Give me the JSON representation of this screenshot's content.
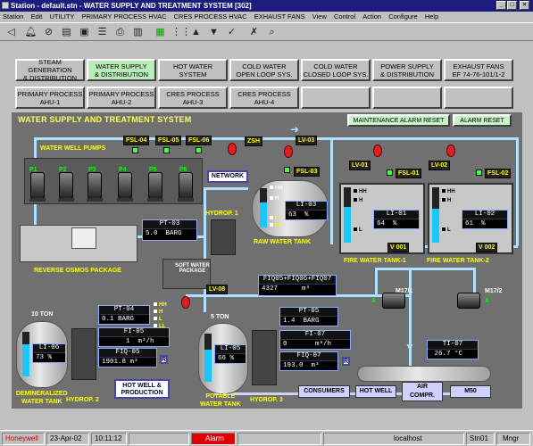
{
  "window": {
    "title": "Station - default.stn - WATER SUPPLY AND TREATMENT SYSTEM [302]",
    "controls": [
      "_",
      "□",
      "×"
    ]
  },
  "menu": [
    "Station",
    "Edit",
    "UTILITY",
    "PRIMARY PROCESS HVAC",
    "CRES PROCESS HVAC",
    "EXHAUST FANS",
    "View",
    "Control",
    "Action",
    "Configure",
    "Help"
  ],
  "toolbar": {
    "icons": [
      "back-icon",
      "bell-icon",
      "silence-icon",
      "report-icon",
      "alarm-summary-icon",
      "list-icon",
      "print-icon",
      "document-icon",
      "chart-icon",
      "grid-icon",
      "up-icon",
      "down-icon",
      "check-icon",
      "cross-icon",
      "search-icon"
    ]
  },
  "nav": {
    "row1": [
      "STEAM GENERATION\n& DISTRIBUTION",
      "WATER SUPPLY\n& DISTRIBUTION",
      "HOT WATER\nSYSTEM",
      "COLD WATER\nOPEN LOOP SYS.",
      "COLD WATER\nCLOSED LOOP SYS.",
      "POWER SUPPLY\n& DISTRIBUTION",
      "EXHAUST FANS\nEF 74-76-101/1-2"
    ],
    "row2": [
      "PRIMARY PROCESS\nAHU-1",
      "PRIMARY PROCESS\nAHU-2",
      "CRES PROCESS\nAHU-3",
      "CRES PROCESS\nAHU-4",
      "",
      "",
      ""
    ],
    "active_index": 1
  },
  "process": {
    "title": "WATER SUPPLY AND TREATMENT SYSTEM",
    "maint_reset": "MAINTENANCE ALARM RESET",
    "alarm_reset": "ALARM RESET",
    "well_pumps_label": "WATER WELL PUMPS",
    "pumps": [
      "P1",
      "P2",
      "P3",
      "P4",
      "P5",
      "P6"
    ],
    "fsl": [
      "FSL-04",
      "FSL-05",
      "FSL-06",
      "FSL-03",
      "FSL-01",
      "FSL-02"
    ],
    "zsh": "ZSH",
    "network": "NETWORK",
    "lv": [
      "LV-03",
      "LV-01",
      "LV-02",
      "LV-08"
    ],
    "raw_tank": {
      "label": "RAW WATER TANK",
      "tag": "LI-03",
      "value": "63",
      "unit": "%",
      "level": 0.63
    },
    "fire1": {
      "label": "FIRE WATER TANK-1",
      "tag": "LI-01",
      "value": "64",
      "unit": "%",
      "valve": "V 001",
      "level": 0.64
    },
    "fire2": {
      "label": "FIRE WATER TANK-2",
      "tag": "LI-02",
      "value": "61",
      "unit": "%",
      "valve": "V 002",
      "level": 0.61
    },
    "pt03": {
      "tag": "PT-03",
      "value": "5.0",
      "unit": "BARG"
    },
    "hydrop1": "HYDROP. 1",
    "ro_label": "REVERSE OSMOS PACKAGE",
    "soft_label": "SOFT WATER\nPACKAGE",
    "ton10": "10 TON",
    "ton5": "5 TON",
    "pt04": {
      "tag": "PT-04",
      "value": "0.1",
      "unit": "BARG"
    },
    "fi05": {
      "tag": "FI-05",
      "value": "1",
      "unit": "m³/h"
    },
    "fiq05": {
      "tag": "FIQ-05",
      "value": "1901.8",
      "unit": "m³"
    },
    "li06": {
      "tag": "LI-06",
      "value": "73",
      "unit": "%",
      "level": 0.73
    },
    "li05": {
      "tag": "LI-05",
      "value": "66",
      "unit": "%",
      "level": 0.66
    },
    "fiq_sum": {
      "tag": "FIQ05+FIQ06+FIQ07",
      "value": "4327",
      "unit": "m³"
    },
    "pt05": {
      "tag": "PT-05",
      "value": "1.4",
      "unit": "BARG"
    },
    "fi07": {
      "tag": "FI-07",
      "value": "0",
      "unit": "m³/h"
    },
    "fiq07": {
      "tag": "FIQ-07",
      "value": "193.0",
      "unit": "m³"
    },
    "ti07": {
      "tag": "TI-07",
      "value": "26.7",
      "unit": "°C"
    },
    "m17_1": "M17/1",
    "m17_2": "M17/2",
    "demin_label": "DEMINERALIZED\nWATER TANK",
    "hydrop2": "HYDROP. 2",
    "potable_label": "POTABLE\nWATER TANK",
    "hydrop3": "HYDROP. 3",
    "hot_well_prod": "HOT WELL &\nPRODUCTION",
    "consumers": "CONSUMERS",
    "hot_well": "HOT WELL",
    "air_compr": "AIR\nCOMPR.",
    "m50": "M50",
    "r": "R",
    "hh": "HH",
    "h": "H",
    "l": "L",
    "ll": "LL",
    "a": "A"
  },
  "status": {
    "brand": "Honeywell",
    "date": "23-Apr-02",
    "time": "10:11:12",
    "alarm": "Alarm",
    "host": "localhost",
    "station": "Stn01",
    "user": "Mngr"
  },
  "colors": {
    "accent": "#1c1c7c",
    "process_bg": "#707070",
    "level_fill": "#19c7ff",
    "alarm": "#e00000",
    "honeywell": "#d40000"
  }
}
